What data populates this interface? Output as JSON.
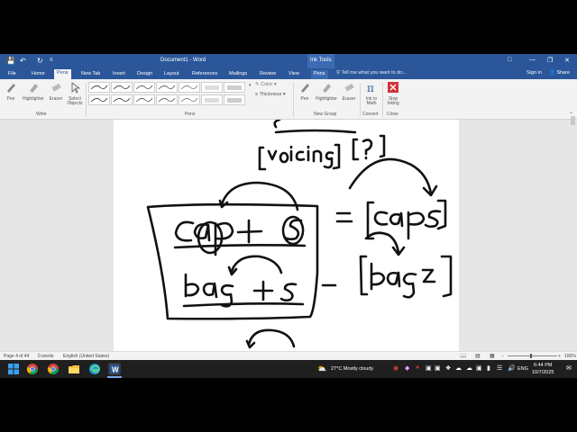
{
  "window": {
    "title": "Document1 - Word",
    "ink_tools": "Ink Tools",
    "pens_context_tab": "Pens"
  },
  "tabs": [
    "File",
    "Home",
    "Pens",
    "New Tab",
    "Insert",
    "Design",
    "Layout",
    "References",
    "Mailings",
    "Review",
    "View"
  ],
  "active_tab": "Pens",
  "tell_me": "Tell me what you want to do...",
  "sign_in": "Sign in",
  "share": "Share",
  "ribbon": {
    "write": {
      "label": "Write",
      "pen": "Pen",
      "highlighter": "Highlighter",
      "eraser": "Eraser",
      "select_objects_1": "Select",
      "select_objects_2": "Objects"
    },
    "pens_group": {
      "label": "Pens",
      "color": "Color",
      "thickness": "Thickness"
    },
    "new_group": {
      "label": "New Group",
      "pen": "Pen",
      "highlighter": "Highlighter",
      "eraser": "Eraser"
    },
    "convert": {
      "label": "Convert",
      "ink_to_math_1": "Ink to",
      "ink_to_math_2": "Math"
    },
    "close": {
      "label": "Close",
      "stop_inking_1": "Stop",
      "stop_inking_2": "Inking"
    }
  },
  "status": {
    "page": "Page 4 of 44",
    "words": "0 words",
    "language": "English (United States)",
    "zoom": "100%"
  },
  "taskbar": {
    "weather": "27°C  Mostly cloudy",
    "lang": "ENG",
    "time": "6:44 PM",
    "date": "10/7/2025"
  },
  "colors": {
    "word_blue": "#2b579a",
    "ribbon_bg": "#f3f3f3",
    "stop_red": "#d13438"
  }
}
